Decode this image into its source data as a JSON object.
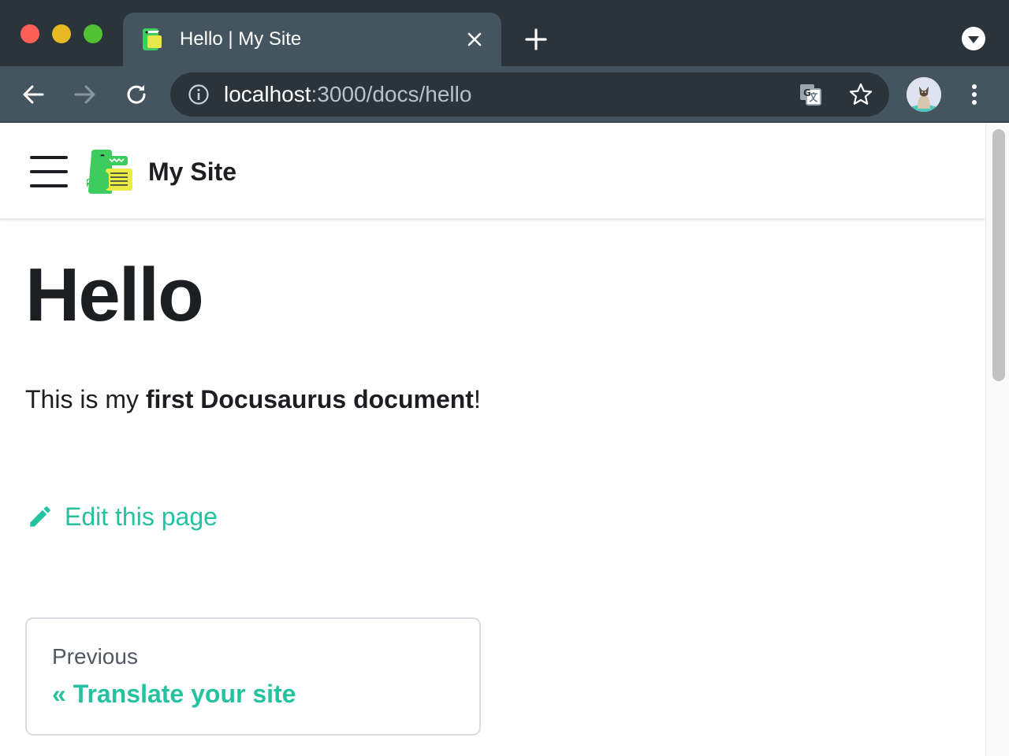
{
  "browser": {
    "tab": {
      "title": "Hello | My Site",
      "favicon": "docusaurus-dino-icon"
    },
    "address": {
      "host": "localhost",
      "path": ":3000/docs/hello"
    },
    "icons": [
      "back-icon",
      "forward-icon",
      "reload-icon",
      "info-icon",
      "translate-icon",
      "star-icon",
      "profile-avatar",
      "more-vert-icon"
    ],
    "colors": {
      "tabbar_bg": "#2b343b",
      "toolbar_bg": "#45555f"
    }
  },
  "navbar": {
    "brand": "My Site",
    "logo": "docusaurus-dino-icon"
  },
  "doc": {
    "title": "Hello",
    "intro_before": "This is my ",
    "intro_bold": "first Docusaurus document",
    "intro_after": "!",
    "edit_link": "Edit this page"
  },
  "pagination": {
    "sublabel": "Previous",
    "label": "« Translate your site"
  },
  "colors": {
    "primary": "#25c2a0",
    "text": "#1c1e21"
  }
}
